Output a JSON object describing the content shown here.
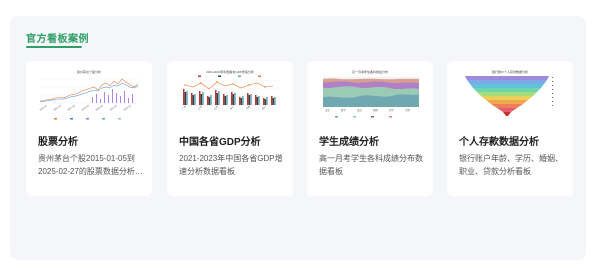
{
  "section": {
    "title": "官方看板案例"
  },
  "cards": [
    {
      "title": "股票分析",
      "desc": "贵州茅台个股2015-01-05到2025-02-27的股票数据分析看板",
      "thumb_title": "贵州茅台个股分析",
      "thumb_icon": "candlestick-line-chart-thumbnail"
    },
    {
      "title": "中国各省GDP分析",
      "desc": "2021-2023年中国各省GDP增速分析数据看板",
      "thumb_title": "2021-2023年中国各省GDP增速分析",
      "thumb_icon": "bar-line-chart-thumbnail"
    },
    {
      "title": "学生成绩分析",
      "desc": "高一月考学生各科成绩分布数据看板",
      "thumb_title": "高一月考学生各科成绩分布",
      "thumb_icon": "stacked-area-chart-thumbnail"
    },
    {
      "title": "个人存款数据分析",
      "desc": "银行账户年龄、学历、婚姻、职业、贷款分析看板",
      "thumb_title": "银行账户个人存款数据分析",
      "thumb_icon": "funnel-chart-thumbnail"
    }
  ],
  "colors": {
    "accent": "#2f9f67",
    "panel_bg": "#f4f6fa",
    "card_bg": "#ffffff",
    "title_text": "#1e1e1e",
    "desc_text": "#555555",
    "thumb_palette": [
      "#c23531",
      "#2f4554",
      "#61a0a8",
      "#d48265",
      "#91c7ae",
      "#ca8622",
      "#bda29a",
      "#6e7074",
      "#9b59b6"
    ]
  }
}
